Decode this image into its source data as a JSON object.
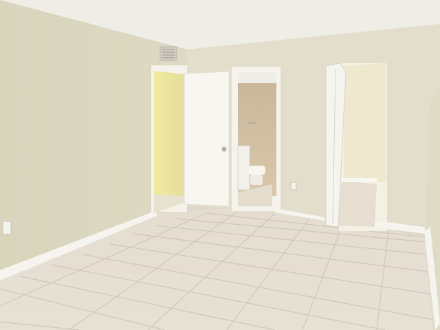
{
  "scene": {
    "subject": "empty-room-interior",
    "colors": {
      "ceiling": "#eeede6",
      "wall_left": "#d9d5bd",
      "wall_back": "#e2decb",
      "wall_right": "#dedbc6",
      "floor_tile": "#e7e0d5",
      "grout": "#cfc6b8",
      "baseboard": "#f6f4ef",
      "door": "#f7f6f1",
      "closet_light": "#eee7a6",
      "bath_tile": "#cdbb9e",
      "hall_wall": "#eee8cf"
    }
  }
}
